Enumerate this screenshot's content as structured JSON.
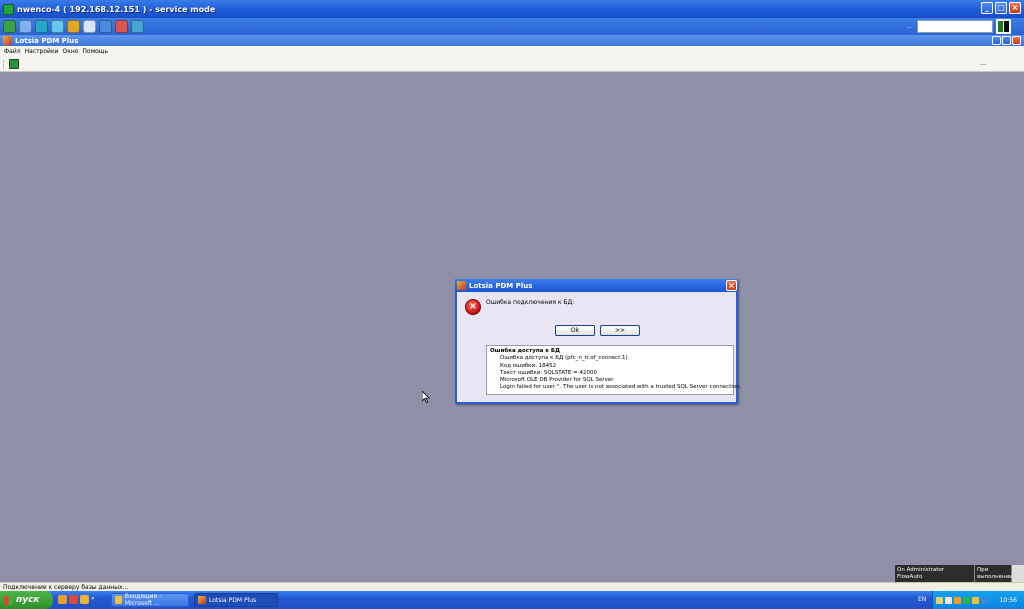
{
  "rdp": {
    "title": "nwenco-4 ( 192.168.12.151 ) - service mode",
    "dots": "..",
    "window_buttons": [
      "_",
      "□",
      "×"
    ]
  },
  "app": {
    "title": "Lotsia PDM Plus",
    "menu": [
      "Файл",
      "Настройки",
      "Окно",
      "Помощь"
    ],
    "toolbar_more": "..."
  },
  "dialog": {
    "title": "Lotsia PDM Plus",
    "message": "Ошибка подключения к БД:",
    "ok_label": "Ok",
    "more_label": ">>",
    "detail": {
      "heading": "Ошибка доступа к БД",
      "lines": [
        "Ошибка доступа к БД  (pfc_n_tr.of_connect.1)",
        "Код ошибки: 18452",
        "Текст ошибки: SQLSTATE = 42000",
        "Microsoft OLE DB Provider for SQL Server",
        "Login failed for user ''. The user is not associated with a trusted SQL Server connection."
      ]
    }
  },
  "statusbar": {
    "text": "Подключение к серверу базы данных..."
  },
  "notification": {
    "line1": "On Administrator",
    "line2": "FlowAuto",
    "line3": "При",
    "line4": "выполнении"
  },
  "taskbar": {
    "start_label": "пуск",
    "quicklaunch_more": "»",
    "tasks": [
      {
        "label": "Входящие - Microsoft ..."
      },
      {
        "label": "Lotsia PDM Plus"
      }
    ],
    "language": "EN",
    "clock": "10:56"
  },
  "colors": {
    "desktop": "#8f8fa8",
    "titlebar": "#1d5ad8",
    "error": "#c01010"
  }
}
